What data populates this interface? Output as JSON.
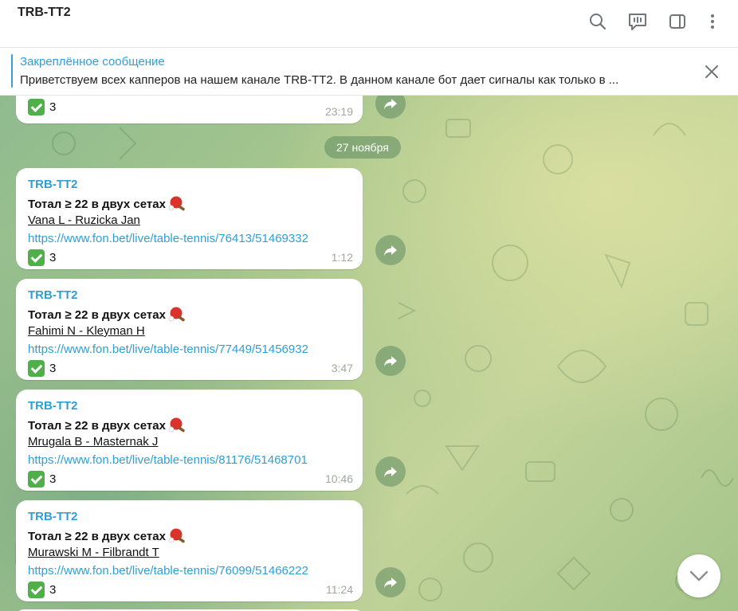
{
  "header": {
    "title": "TRB-TT2",
    "buttons": [
      "search-icon",
      "live-stream-icon",
      "sidebar-toggle-icon",
      "more-icon"
    ]
  },
  "pinned": {
    "title": "Закреплённое сообщение",
    "text": "Приветствуем всех капперов на нашем канале TRB-TT2. В данном канале бот дает сигналы как только в ..."
  },
  "partial_message": {
    "result": "3",
    "time": "23:19"
  },
  "date_separator": "27 ноября",
  "messages": [
    {
      "sender": "TRB-TT2",
      "bet": "Тотал ≥ 22 в двух сетах",
      "match": "Vana L - Ruzicka Jan",
      "link": "https://www.fon.bet/live/table-tennis/76413/51469332",
      "result": "3",
      "time": "1:12"
    },
    {
      "sender": "TRB-TT2",
      "bet": "Тотал ≥ 22 в двух сетах",
      "match": "Fahimi N - Kleyman H",
      "link": "https://www.fon.bet/live/table-tennis/77449/51456932",
      "result": "3",
      "time": "3:47"
    },
    {
      "sender": "TRB-TT2",
      "bet": "Тотал ≥ 22 в двух сетах",
      "match": "Mrugala B - Masternak J",
      "link": "https://www.fon.bet/live/table-tennis/81176/51468701",
      "result": "3",
      "time": "10:46"
    },
    {
      "sender": "TRB-TT2",
      "bet": "Тотал ≥ 22 в двух сетах",
      "match": "Murawski M - Filbrandt T",
      "link": "https://www.fon.bet/live/table-tennis/76099/51466222",
      "result": "3",
      "time": "11:24"
    }
  ],
  "colors": {
    "accent": "#2f9fd5",
    "check_green": "#4fb04a",
    "chat_bg": "#a9c78d"
  }
}
